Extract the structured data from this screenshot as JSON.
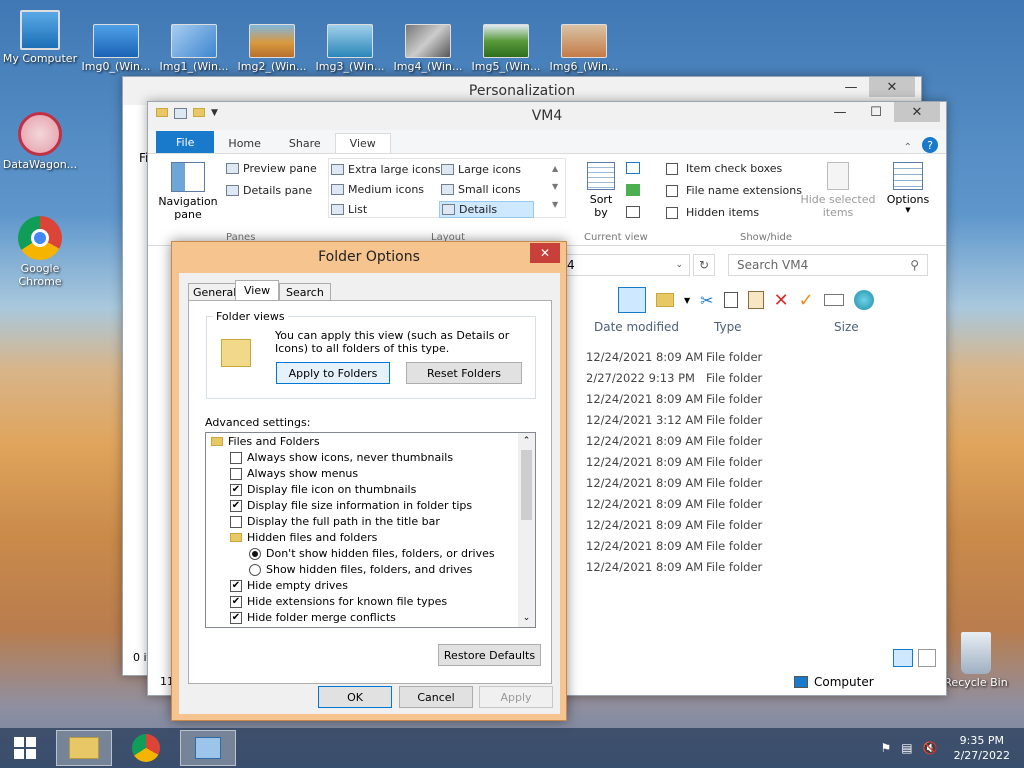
{
  "desktop": {
    "icons": [
      {
        "label": "My Computer"
      },
      {
        "label": "Img0_(Win..."
      },
      {
        "label": "Img1_(Win..."
      },
      {
        "label": "Img2_(Win..."
      },
      {
        "label": "Img3_(Win..."
      },
      {
        "label": "Img4_(Win..."
      },
      {
        "label": "Img5_(Win..."
      },
      {
        "label": "Img6_(Win..."
      },
      {
        "label": "DataWagon..."
      },
      {
        "label": "Google Chrome"
      },
      {
        "label": "Recycle Bin"
      }
    ]
  },
  "personalization": {
    "title": "Personalization",
    "partial_label": "Fi",
    "status_partial": "0 it",
    "status_partial2": "11"
  },
  "explorer": {
    "title": "VM4",
    "tabs": [
      "File",
      "Home",
      "Share",
      "View"
    ],
    "active_tab": "View",
    "panes": {
      "navigation_pane": "Navigation pane",
      "preview_pane": "Preview pane",
      "details_pane": "Details pane",
      "group_label": "Panes"
    },
    "layout": {
      "items": [
        "Extra large icons",
        "Large icons",
        "Medium icons",
        "Small icons",
        "List",
        "Details"
      ],
      "selected": "Details",
      "group_label": "Layout"
    },
    "current_view": {
      "sort_by": "Sort by",
      "group_label": "Current view"
    },
    "show_hide": {
      "item_check_boxes": "Item check boxes",
      "file_name_extensions": "File name extensions",
      "hidden_items": "Hidden items",
      "hide_selected_items": "Hide selected items",
      "group_label": "Show/hide"
    },
    "options_label": "Options",
    "address_partial": "4",
    "search_placeholder": "Search VM4",
    "columns": {
      "date_modified": "Date modified",
      "type": "Type",
      "size": "Size"
    },
    "rows": [
      {
        "date": "12/24/2021 8:09 AM",
        "type": "File folder"
      },
      {
        "date": "2/27/2022 9:13 PM",
        "type": "File folder"
      },
      {
        "date": "12/24/2021 8:09 AM",
        "type": "File folder"
      },
      {
        "date": "12/24/2021 3:12 AM",
        "type": "File folder"
      },
      {
        "date": "12/24/2021 8:09 AM",
        "type": "File folder"
      },
      {
        "date": "12/24/2021 8:09 AM",
        "type": "File folder"
      },
      {
        "date": "12/24/2021 8:09 AM",
        "type": "File folder"
      },
      {
        "date": "12/24/2021 8:09 AM",
        "type": "File folder"
      },
      {
        "date": "12/24/2021 8:09 AM",
        "type": "File folder"
      },
      {
        "date": "12/24/2021 8:09 AM",
        "type": "File folder"
      },
      {
        "date": "12/24/2021 8:09 AM",
        "type": "File folder"
      }
    ],
    "status_computer": "Computer"
  },
  "folder_options": {
    "title": "Folder Options",
    "tabs": [
      "General",
      "View",
      "Search"
    ],
    "active_tab": "View",
    "folder_views": {
      "legend": "Folder views",
      "description": "You can apply this view (such as Details or Icons) to all folders of this type.",
      "apply_button": "Apply to Folders",
      "reset_button": "Reset Folders"
    },
    "advanced_label": "Advanced settings:",
    "settings": [
      {
        "kind": "folder",
        "label": "Files and Folders",
        "level": 0
      },
      {
        "kind": "check",
        "label": "Always show icons, never thumbnails",
        "checked": false,
        "level": 1
      },
      {
        "kind": "check",
        "label": "Always show menus",
        "checked": false,
        "level": 1
      },
      {
        "kind": "check",
        "label": "Display file icon on thumbnails",
        "checked": true,
        "level": 1
      },
      {
        "kind": "check",
        "label": "Display file size information in folder tips",
        "checked": true,
        "level": 1
      },
      {
        "kind": "check",
        "label": "Display the full path in the title bar",
        "checked": false,
        "level": 1
      },
      {
        "kind": "folder",
        "label": "Hidden files and folders",
        "level": 1
      },
      {
        "kind": "radio",
        "label": "Don't show hidden files, folders, or drives",
        "checked": true,
        "level": 2
      },
      {
        "kind": "radio",
        "label": "Show hidden files, folders, and drives",
        "checked": false,
        "level": 2
      },
      {
        "kind": "check",
        "label": "Hide empty drives",
        "checked": true,
        "level": 1
      },
      {
        "kind": "check",
        "label": "Hide extensions for known file types",
        "checked": true,
        "level": 1
      },
      {
        "kind": "check",
        "label": "Hide folder merge conflicts",
        "checked": true,
        "level": 1
      }
    ],
    "restore_defaults": "Restore Defaults",
    "ok": "OK",
    "cancel": "Cancel",
    "apply": "Apply"
  },
  "taskbar": {
    "time": "9:35 PM",
    "date": "2/27/2022"
  }
}
